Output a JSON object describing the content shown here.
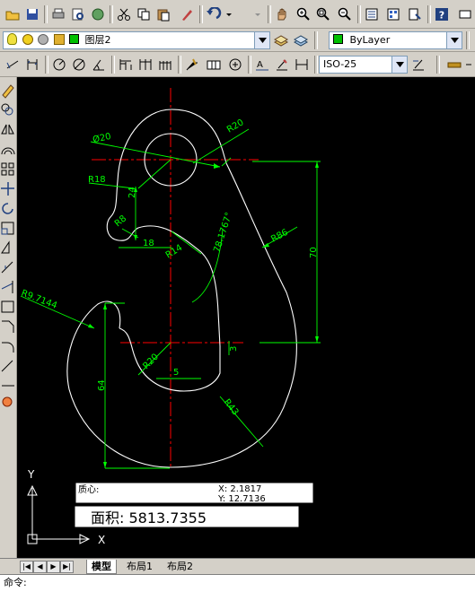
{
  "layer_toolbar": {
    "layer_name": "图层2",
    "color_value": "ByLayer"
  },
  "dim_toolbar": {
    "dimstyle_value": "ISO-25"
  },
  "drawing": {
    "dimensions": {
      "dia20": "Ø20",
      "r20_top": "R20",
      "r18": "R18",
      "d24": "24",
      "r8": "R8",
      "d18": "18",
      "r14": "R14",
      "angle": "78.1767°",
      "r86": "R86",
      "d70": "70",
      "r9": "R9.7144",
      "d64": "64",
      "r20_bottom": "R20",
      "d5": "5",
      "d3": "3",
      "r43": "R43"
    },
    "centroid_box": {
      "label": "质心:",
      "x_line": "X:  2.1817",
      "y_line": "Y:  12.7136"
    },
    "area_box": {
      "text": "面积: 5813.7355"
    },
    "ucs": {
      "y": "Y",
      "x": "X"
    }
  },
  "tabs": [
    "模型",
    "布局1",
    "布局2"
  ],
  "command_line": "命令:",
  "colors": {
    "background": "#000000",
    "geometry": "#ffffff",
    "centerline": "#ff0000",
    "dimension": "#00ff00",
    "layer_swatch": "#00c000"
  }
}
